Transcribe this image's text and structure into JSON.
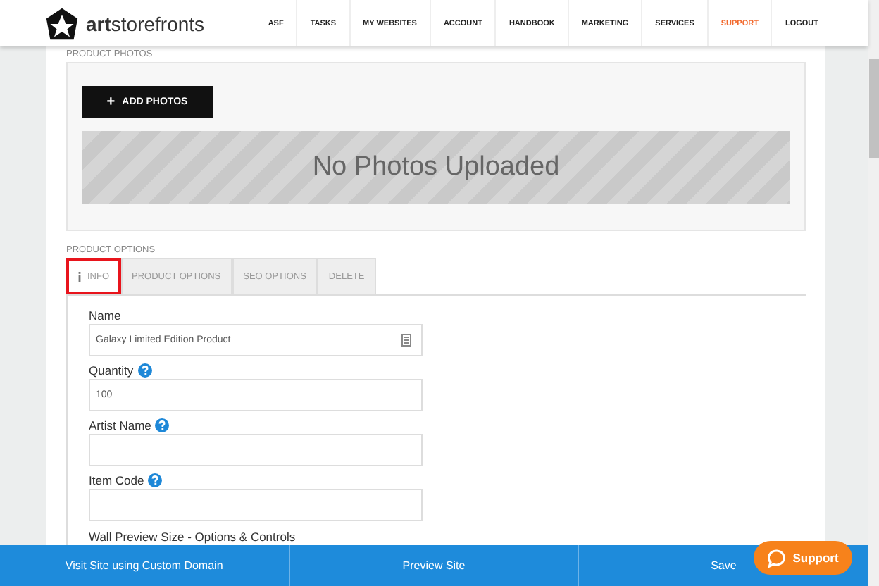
{
  "header": {
    "logo_text": "**art**storefronts",
    "nav": [
      {
        "label": "ASF",
        "selected": false
      },
      {
        "label": "TASKS",
        "selected": false
      },
      {
        "label": "MY WEBSITES",
        "selected": false
      },
      {
        "label": "ACCOUNT",
        "selected": false
      },
      {
        "label": "HANDBOOK",
        "selected": false
      },
      {
        "label": "MARKETING",
        "selected": false
      },
      {
        "label": "SERVICES",
        "selected": false
      },
      {
        "label": "SUPPORT",
        "selected": true
      },
      {
        "label": "LOGOUT",
        "selected": false
      }
    ]
  },
  "photos": {
    "heading": "PRODUCT PHOTOS",
    "add_button": "ADD PHOTOS",
    "add_icon": "+",
    "empty_text": "No Photos Uploaded"
  },
  "options": {
    "heading": "PRODUCT OPTIONS",
    "tabs": [
      {
        "label": "INFO",
        "selected": true,
        "has_icon": true
      },
      {
        "label": "PRODUCT OPTIONS",
        "selected": false,
        "has_icon": false
      },
      {
        "label": "SEO OPTIONS",
        "selected": false,
        "has_icon": false
      },
      {
        "label": "DELETE",
        "selected": false,
        "has_icon": false
      }
    ],
    "fields": [
      {
        "label": "Name",
        "value": "Galaxy Limited Edition Product",
        "help": false,
        "clip_icon": true
      },
      {
        "label": "Quantity",
        "value": "100",
        "help": true,
        "clip_icon": false
      },
      {
        "label": "Artist Name",
        "help": true,
        "clip_icon": false
      },
      {
        "label": "Item Code",
        "help": true,
        "clip_icon": false
      }
    ],
    "section_label": "Wall Preview Size - Options & Controls"
  },
  "bottom_bar": [
    "Visit Site using Custom Domain",
    "Preview Site",
    "Save"
  ],
  "support_button": "Support"
}
